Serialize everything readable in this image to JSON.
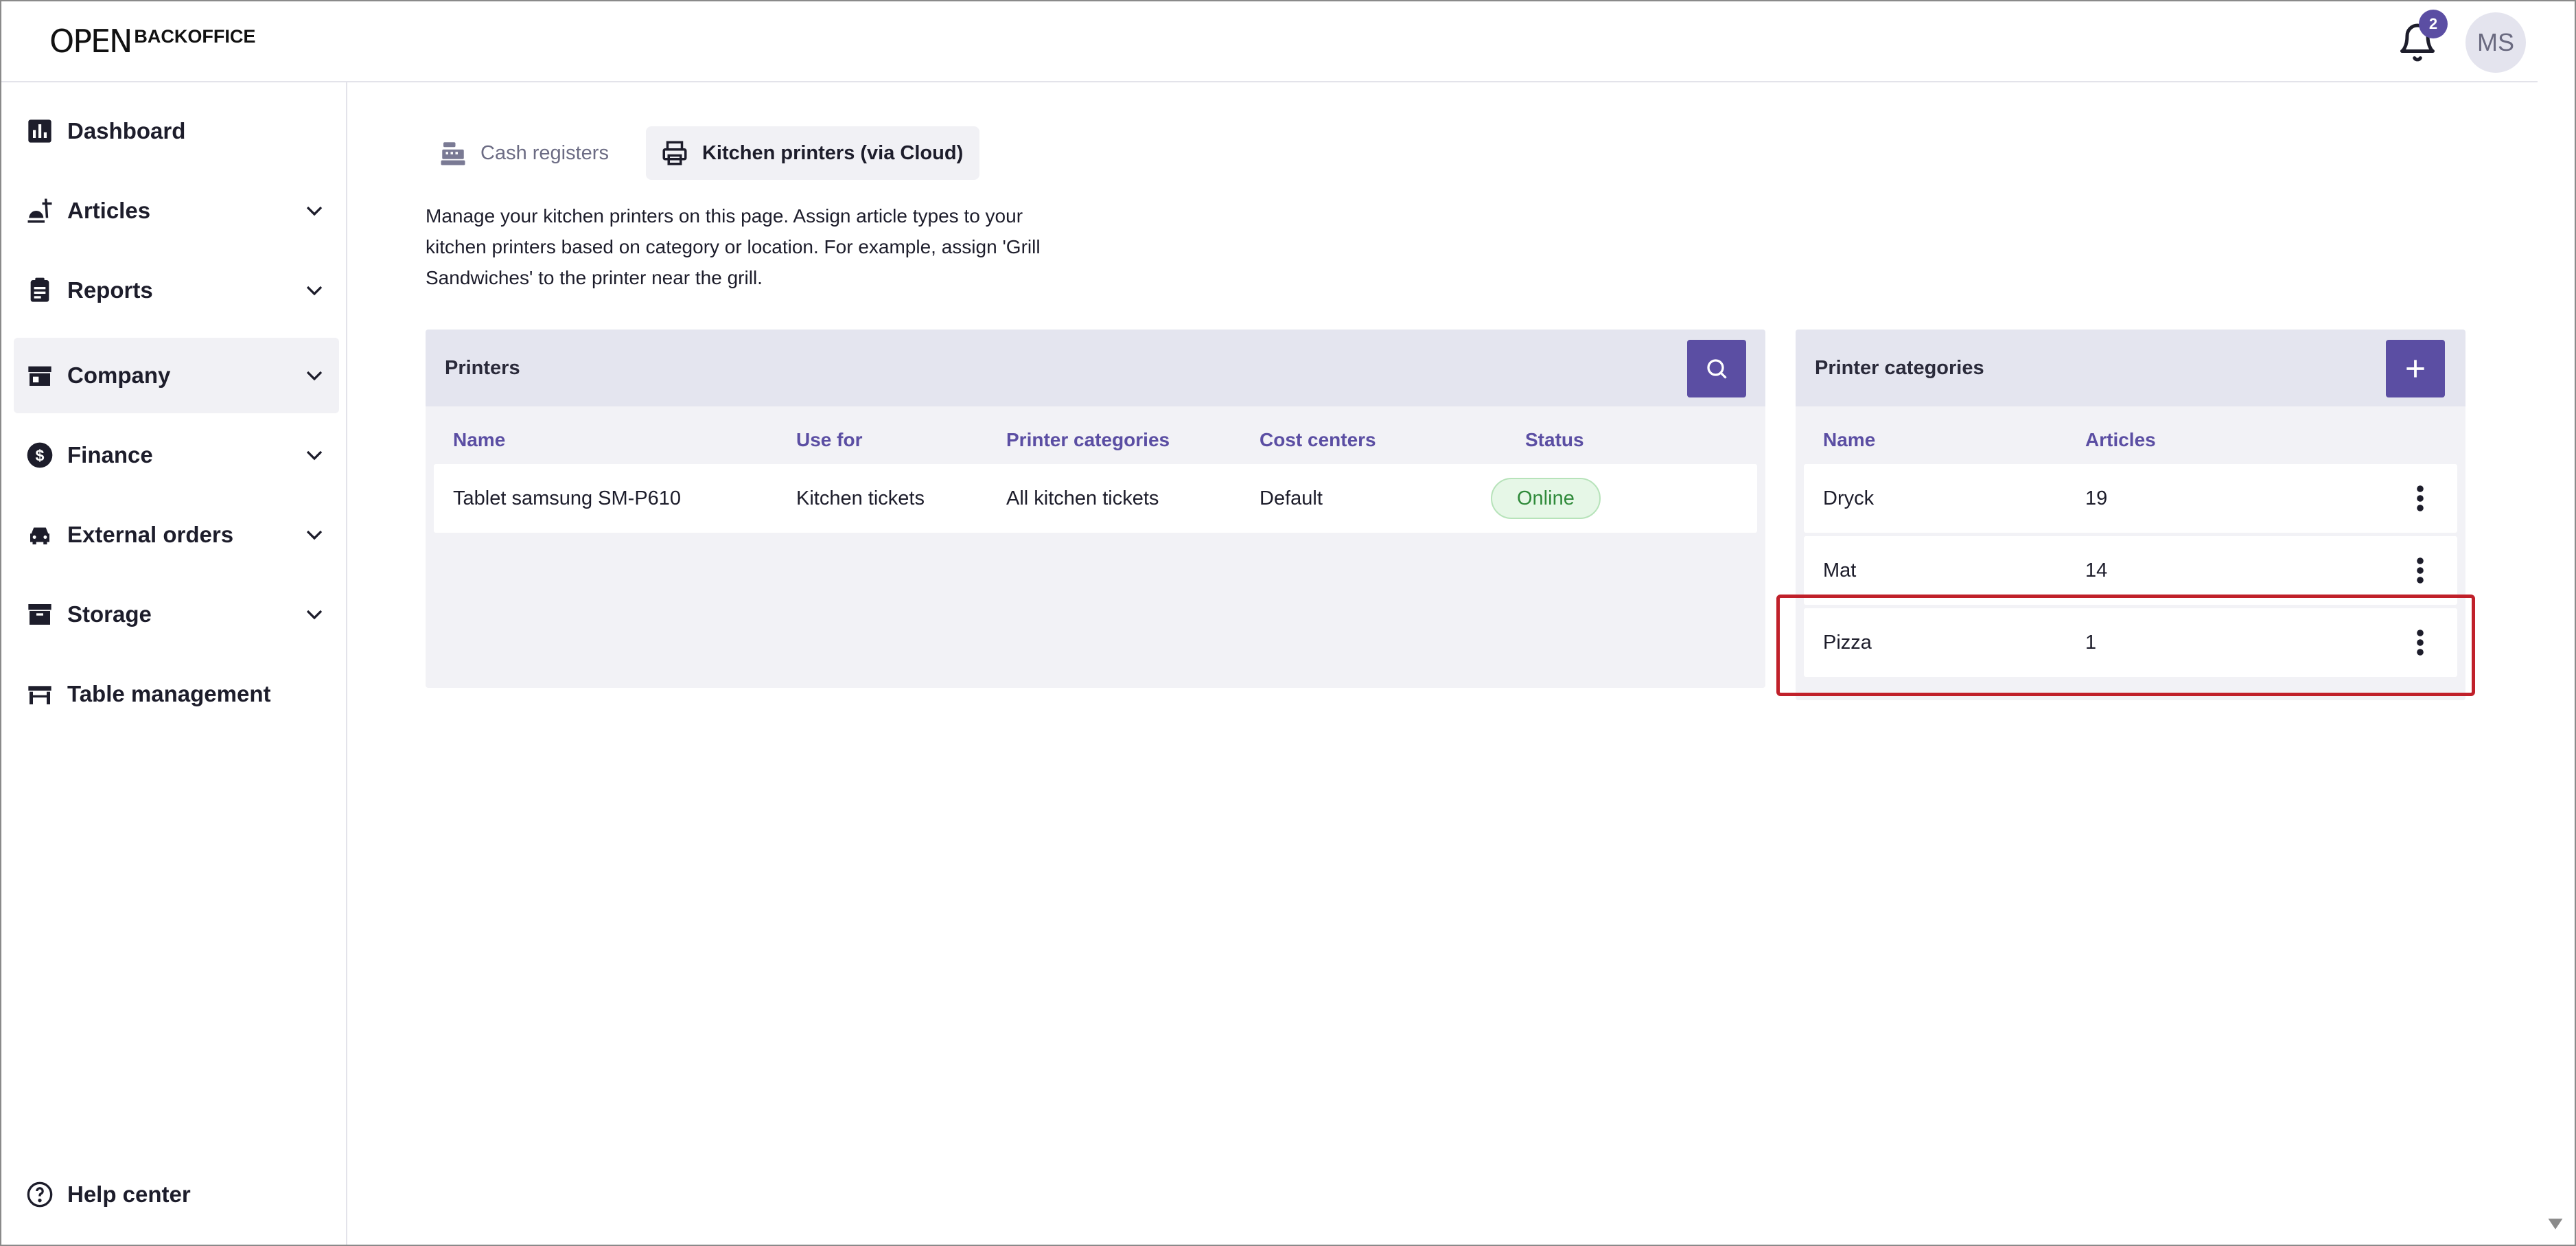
{
  "brand": {
    "logo_mark": "OPEN",
    "logo_text": "BACKOFFICE"
  },
  "header": {
    "notification_count": "2",
    "avatar_initials": "MS"
  },
  "sidebar": {
    "items": [
      {
        "label": "Dashboard",
        "icon": "bar-chart-icon",
        "expandable": false
      },
      {
        "label": "Articles",
        "icon": "food-icon",
        "expandable": true
      },
      {
        "label": "Reports",
        "icon": "clipboard-icon",
        "expandable": true
      },
      {
        "label": "Company",
        "icon": "store-icon",
        "expandable": true,
        "active": true
      },
      {
        "label": "Finance",
        "icon": "dollar-icon",
        "expandable": true
      },
      {
        "label": "External orders",
        "icon": "car-icon",
        "expandable": true
      },
      {
        "label": "Storage",
        "icon": "archive-icon",
        "expandable": true
      },
      {
        "label": "Table management",
        "icon": "table-icon",
        "expandable": false
      }
    ],
    "help": {
      "label": "Help center",
      "icon": "help-circle-icon"
    }
  },
  "tabs": [
    {
      "label": "Cash registers",
      "icon": "cash-register-icon",
      "active": false
    },
    {
      "label": "Kitchen printers (via Cloud)",
      "icon": "printer-icon",
      "active": true
    }
  ],
  "description": "Manage your kitchen printers on this page. Assign article types to your kitchen printers based on category or location. For example, assign 'Grill Sandwiches' to the printer near the grill.",
  "printers_panel": {
    "title": "Printers",
    "columns": [
      "Name",
      "Use for",
      "Printer categories",
      "Cost centers",
      "Status"
    ],
    "rows": [
      {
        "name": "Tablet samsung SM-P610",
        "use_for": "Kitchen tickets",
        "printer_categories": "All kitchen tickets",
        "cost_centers": "Default",
        "status": "Online"
      }
    ]
  },
  "categories_panel": {
    "title": "Printer categories",
    "columns": [
      "Name",
      "Articles"
    ],
    "rows": [
      {
        "name": "Dryck",
        "articles": "19"
      },
      {
        "name": "Mat",
        "articles": "14"
      },
      {
        "name": "Pizza",
        "articles": "1"
      }
    ]
  },
  "colors": {
    "accent": "#5b4ea3",
    "highlight": "#c0202a",
    "online": "#2f8a3a"
  }
}
